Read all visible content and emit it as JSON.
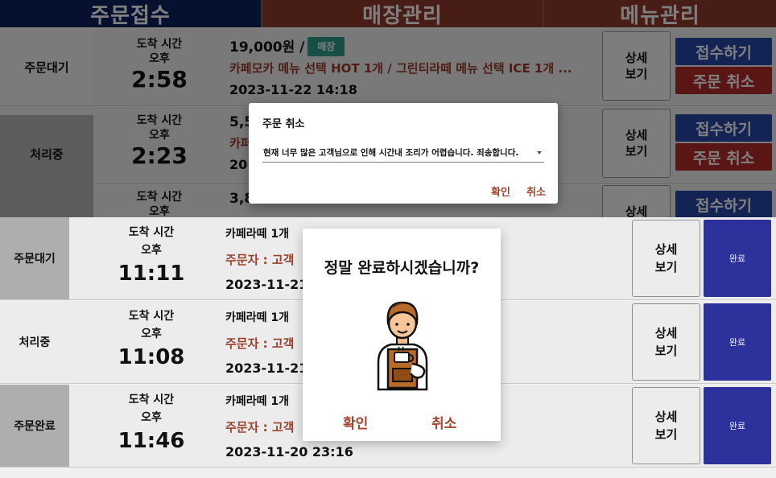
{
  "tabs": [
    {
      "label": "주문접수"
    },
    {
      "label": "매장관리"
    },
    {
      "label": "메뉴관리"
    }
  ],
  "top_orders": [
    {
      "status": "주문대기",
      "arrival_label": "도착 시간",
      "ampm": "오후",
      "time": "2:58",
      "price": "19,000원 /",
      "badge": "매장",
      "menu": "카페모카 메뉴 선택 HOT 1개 / 그린티라떼 메뉴 선택 ICE 1개 ...",
      "date": "2023-11-22 14:18",
      "detail_label_1": "상세",
      "detail_label_2": "보기",
      "accept_label": "접수하기",
      "cancel_label": "주문 취소"
    },
    {
      "status": "처리중",
      "arrival_label": "도착 시간",
      "ampm": "오후",
      "time": "2:23",
      "price": "5,5",
      "menu": "카퍼",
      "date": "20",
      "detail_label_1": "상세",
      "detail_label_2": "보기",
      "accept_label": "접수하기",
      "cancel_label": "주문 취소"
    },
    {
      "arrival_label": "도착 시간",
      "ampm": "오후",
      "price": "3,8",
      "detail_label_1": "상세",
      "accept_label": "접수하기"
    }
  ],
  "cancel_dialog": {
    "title": "주문 취소",
    "reason": "현재 너무 많은 고객님으로 인해 시간내 조리가 어렵습니다. 죄송합니다.",
    "confirm": "확인",
    "cancel": "취소"
  },
  "bottom_orders": [
    {
      "status": "주문대기",
      "arrival_label": "도착 시간",
      "ampm": "오후",
      "time": "11:11",
      "menu": "카페라떼 1개",
      "orderer": "주문자 : 고객",
      "date": "2023-11-21",
      "detail_label_1": "상세",
      "detail_label_2": "보기",
      "complete_label": "완료"
    },
    {
      "status": "처리중",
      "arrival_label": "도착 시간",
      "ampm": "오후",
      "time": "11:08",
      "menu": "카페라떼 1개",
      "orderer": "주문자 : 고객",
      "date": "2023-11-21",
      "detail_label_1": "상세",
      "detail_label_2": "보기",
      "complete_label": "완료"
    },
    {
      "status": "주문완료",
      "arrival_label": "도착 시간",
      "ampm": "오후",
      "time": "11:46",
      "menu": "카페라떼 1개",
      "orderer": "주문자 : 고객",
      "date": "2023-11-20 23:16",
      "detail_label_1": "상세",
      "detail_label_2": "보기",
      "complete_label": "완료"
    }
  ],
  "complete_dialog": {
    "question": "정말 완료하시겠습니까?",
    "confirm": "확인",
    "cancel": "취소",
    "illustration": "barista-icon"
  },
  "colors": {
    "navy": "#0c2360",
    "brown": "#8f3a2c",
    "accept_blue": "#2748a8",
    "cancel_red": "#b42a2a",
    "complete_blue": "#2f35a6",
    "badge_teal": "#2f9e8f",
    "accent_text": "#a4442e"
  }
}
